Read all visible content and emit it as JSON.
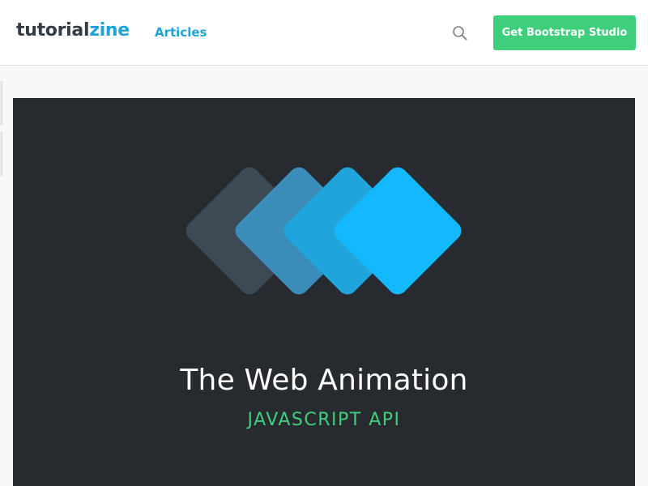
{
  "header": {
    "logo_part1": "tutorial",
    "logo_part2": "zine",
    "nav_articles": "Articles",
    "cta_label": "Get Bootstrap Studio",
    "search_icon": "search-icon"
  },
  "hero": {
    "title": "The Web Animation",
    "subtitle": "JAVASCRIPT API",
    "diamond_colors": [
      "#3b4a54",
      "#3a8db8",
      "#1fa4dc",
      "#14b8ff"
    ]
  },
  "colors": {
    "brand_blue": "#1fa3d8",
    "accent_green": "#3fcf7c",
    "hero_bg": "#272b2f"
  }
}
